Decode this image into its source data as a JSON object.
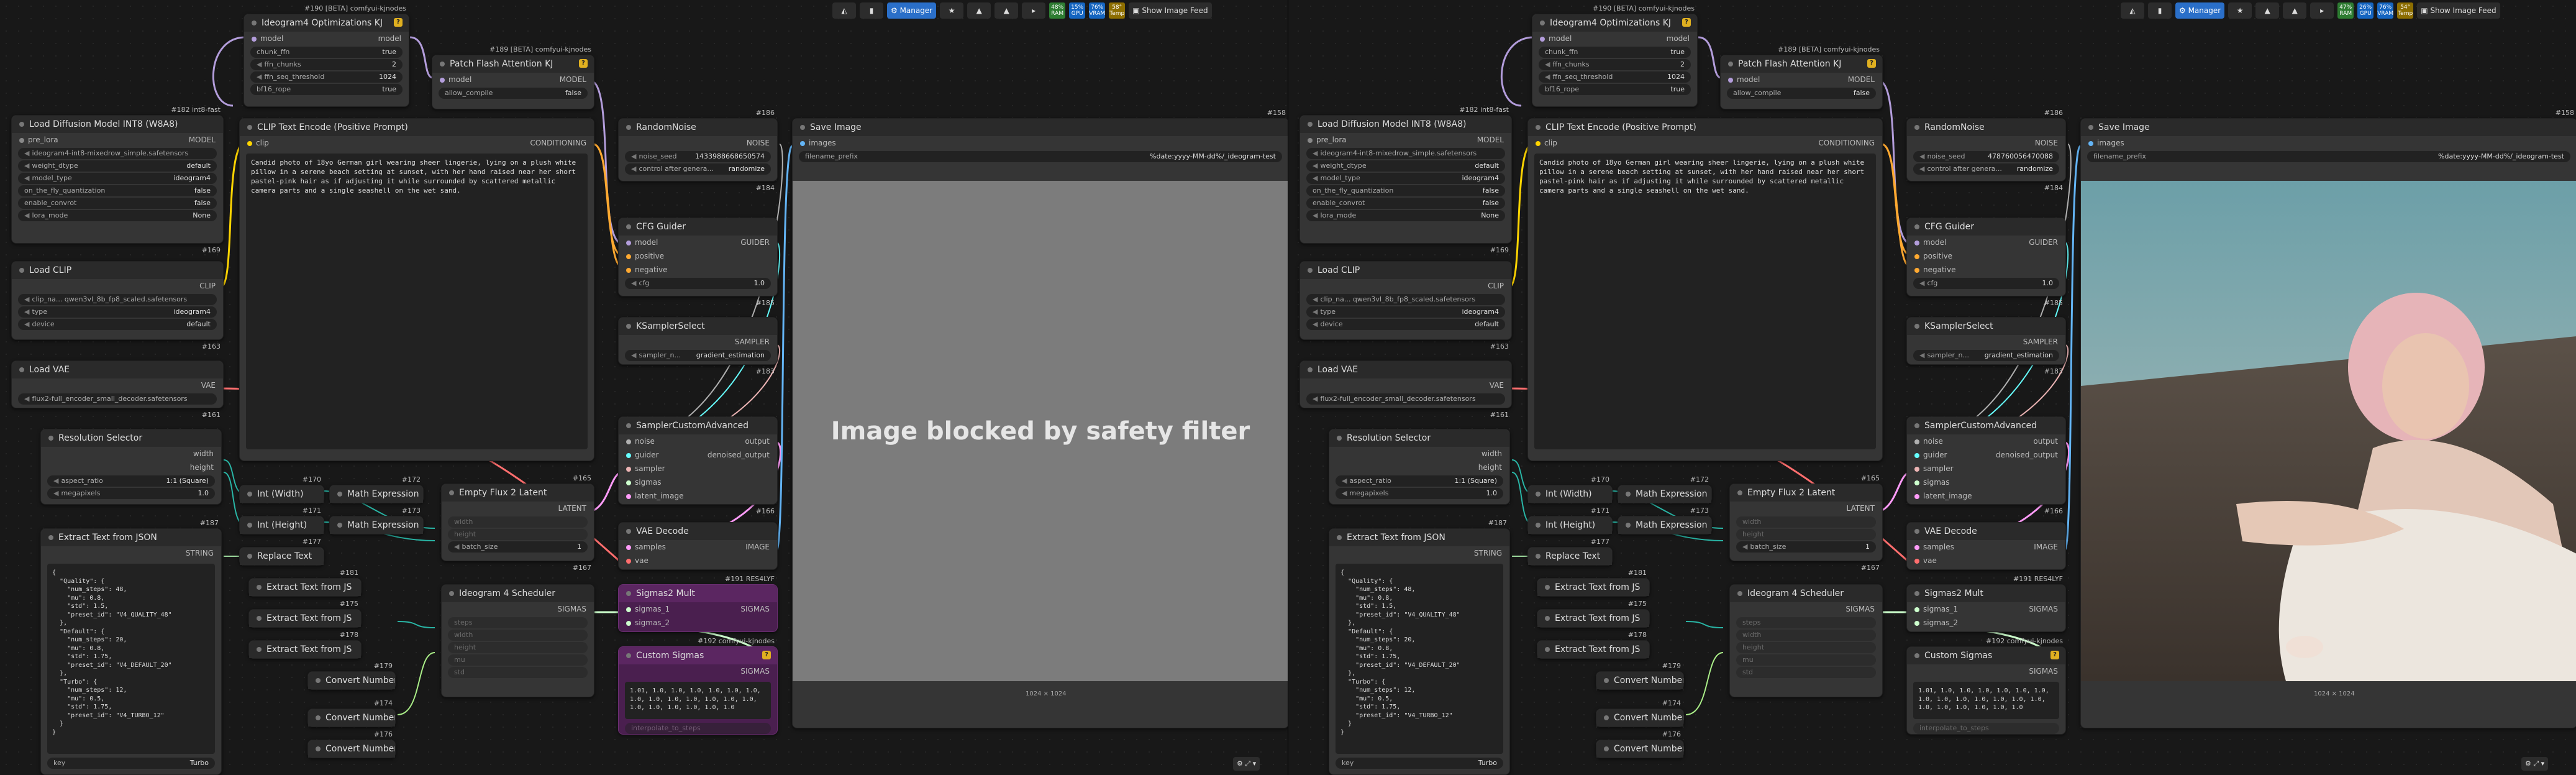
{
  "colors": {
    "model": "#b39ddb",
    "clip": "#ffd500",
    "vae": "#ff6e6e",
    "conditioning": "#ffa931",
    "latent": "#ff9cf9",
    "image": "#64b5f6",
    "int": "#29b6a6",
    "string": "#9cd89c",
    "float": "#aaee88",
    "sigmas": "#cdffcd",
    "noise": "#b0b0b0",
    "guider": "#66ffff",
    "sampler": "#ecb4b4"
  },
  "toolbar": {
    "manager": "Manager",
    "show_feed": "Show Image Feed",
    "pct1": "48%",
    "pct2": "15%",
    "pct3": "76%",
    "pct4": "58°",
    "r_pct1": "47%",
    "r_pct2": "26%",
    "r_pct3": "76%",
    "r_pct4": "54°",
    "lbl_ram": "RAM",
    "lbl_gpu": "GPU",
    "lbl_vram": "VRAM",
    "lbl_temp": "Temp"
  },
  "nodes": {
    "ideo_opt": {
      "id": "#190 [BETA] comfyui-kjnodes",
      "title": "Ideogram4 Optimizations KJ",
      "in_model": "model",
      "out_model": "model",
      "chunk_ffn": "chunk_ffn",
      "chunk_ffn_v": "true",
      "ffn_chunks": "ffn_chunks",
      "ffn_chunks_v": "2",
      "ffn_seq": "ffn_seq_threshold",
      "ffn_seq_v": "1024",
      "bf16": "bf16_rope",
      "bf16_v": "true"
    },
    "patch_flash": {
      "id": "#189 [BETA] comfyui-kjnodes",
      "title": "Patch Flash Attention KJ",
      "in_model": "model",
      "out_model": "MODEL",
      "allow": "allow_compile",
      "allow_v": "false"
    },
    "load_diff": {
      "id": "#182 int8-fast",
      "title": "Load Diffusion Model INT8 (W8A8)",
      "pre_lora": "pre_lora",
      "out_model": "MODEL",
      "unet": "ideogram4-int8-mixedrow_simple.safetensors",
      "wdtype": "weight_dtype",
      "wdtype_v": "default",
      "mtype": "model_type",
      "mtype_v": "ideogram4",
      "otf": "on_the_fly_quantization",
      "otf_v": "false",
      "convrot": "enable_convrot",
      "convrot_v": "false",
      "lora": "lora_mode",
      "lora_v": "None",
      "foot": "#169"
    },
    "clip_enc": {
      "title": "CLIP Text Encode (Positive Prompt)",
      "in_clip": "clip",
      "out_cond": "CONDITIONING",
      "prompt": "Candid photo of 18yo German girl wearing sheer lingerie, lying on a plush white pillow in a serene beach setting at sunset, with her hand raised near her short pastel-pink hair as if adjusting it while surrounded by scattered metallic camera parts and a single seashell on the wet sand."
    },
    "load_clip": {
      "title": "Load CLIP",
      "out_clip": "CLIP",
      "clip_name": "clip_na...",
      "clip_v": "qwen3vl_8b_fp8_scaled.safetensors",
      "type": "type",
      "type_v": "ideogram4",
      "device": "device",
      "device_v": "default",
      "foot": "#163"
    },
    "load_vae": {
      "title": "Load VAE",
      "out_vae": "VAE",
      "vae_v": "flux2-full_encoder_small_decoder.safetensors",
      "foot": "#161"
    },
    "res_sel": {
      "title": "Resolution Selector",
      "out_w": "width",
      "out_h": "height",
      "aspect": "aspect_ratio",
      "aspect_v": "1:1 (Square)",
      "mp": "megapixels",
      "mp_v": "1.0"
    },
    "extract_json": {
      "id": "#187",
      "title": "Extract Text from JSON",
      "out": "STRING",
      "json": "{\n  \"Quality\": {\n    \"num_steps\": 48,\n    \"mu\": 0.8,\n    \"std\": 1.5,\n    \"preset_id\": \"V4_QUALITY_48\"\n  },\n  \"Default\": {\n    \"num_steps\": 20,\n    \"mu\": 0.8,\n    \"std\": 1.75,\n    \"preset_id\": \"V4_DEFAULT_20\"\n  },\n  \"Turbo\": {\n    \"num_steps\": 12,\n    \"mu\": 0.5,\n    \"std\": 1.75,\n    \"preset_id\": \"V4_TURBO_12\"\n  }\n}",
      "key": "key",
      "key_v": "Turbo"
    },
    "int_w": {
      "id": "#170",
      "title": "Int (Width)"
    },
    "int_h": {
      "id": "#171",
      "title": "Int (Height)"
    },
    "math1": {
      "id": "#172",
      "title": "Math Expression"
    },
    "math2": {
      "id": "#173",
      "title": "Math Expression"
    },
    "replace": {
      "id": "#177",
      "title": "Replace Text"
    },
    "ext_js1": {
      "id": "#181",
      "title": "Extract Text from JS"
    },
    "ext_js2": {
      "id": "#175",
      "title": "Extract Text from JS"
    },
    "ext_js3": {
      "id": "#178",
      "title": "Extract Text from JS"
    },
    "conv1": {
      "id": "#179",
      "title": "Convert Number"
    },
    "conv2": {
      "id": "#174",
      "title": "Convert Number"
    },
    "conv3": {
      "id": "#176",
      "title": "Convert Number"
    },
    "empty_latent": {
      "id": "#165",
      "title": "Empty Flux 2 Latent",
      "out": "LATENT",
      "w": "width",
      "h": "height",
      "batch": "batch_size",
      "batch_v": "1",
      "foot": "#167"
    },
    "sched": {
      "title": "Ideogram 4 Scheduler",
      "out": "SIGMAS",
      "p1": "steps",
      "p2": "width",
      "p3": "height",
      "p4": "mu",
      "p5": "std"
    },
    "noise": {
      "id": "#186",
      "title": "RandomNoise",
      "out": "NOISE",
      "seed": "noise_seed",
      "seed_v": "1433988668650574",
      "seed_r": "478760056470088",
      "ctrl": "control after genera...",
      "ctrl_v": "randomize",
      "foot": "#184"
    },
    "cfg": {
      "title": "CFG Guider",
      "model": "model",
      "pos": "positive",
      "neg": "negative",
      "out": "GUIDER",
      "cfg": "cfg",
      "cfg_v": "1.0",
      "foot": "#185"
    },
    "ksel": {
      "title": "KSamplerSelect",
      "out": "SAMPLER",
      "sn": "sampler_n...",
      "sn_v": "gradient_estimation",
      "foot": "#183"
    },
    "sca": {
      "title": "SamplerCustomAdvanced",
      "noise": "noise",
      "guider": "guider",
      "sampler": "sampler",
      "sigmas": "sigmas",
      "latent": "latent_image",
      "o1": "output",
      "o2": "denoised_output",
      "foot": "#166"
    },
    "vaedec": {
      "title": "VAE Decode",
      "samples": "samples",
      "vae": "vae",
      "out": "IMAGE"
    },
    "sig2mult": {
      "id": "#191 RES4LYF",
      "title": "Sigmas2 Mult",
      "s1": "sigmas_1",
      "s2": "sigmas_2",
      "out": "SIGMAS"
    },
    "custom_sig": {
      "id": "#192 comfyui-kjnodes",
      "title": "Custom Sigmas",
      "out": "SIGMAS",
      "vals": "1.01, 1.0, 1.0, 1.0, 1.0, 1.0, 1.0,\n1.0, 1.0, 1.0, 1.0, 1.0, 1.0, 1.0,\n1.0, 1.0, 1.0, 1.0, 1.0, 1.0",
      "interp": "interpolate_to_steps"
    },
    "save": {
      "id": "#158",
      "title": "Save Image",
      "in": "images",
      "prefix": "filename_prefix",
      "prefix_v": "%date:yyyy-MM-dd%/_ideogram-test",
      "blocked": "Image blocked by safety filter",
      "size": "1024 × 1024"
    }
  }
}
